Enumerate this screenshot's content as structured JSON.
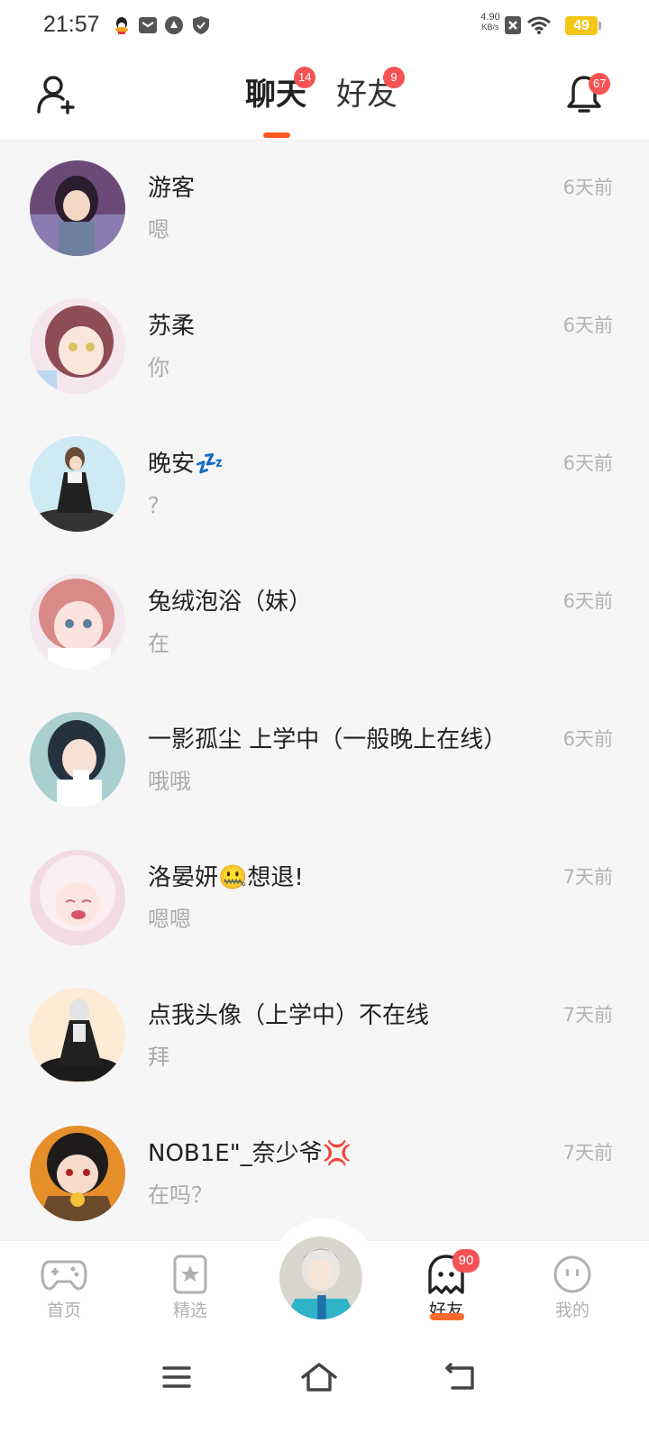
{
  "status_bar": {
    "time": "21:57",
    "net_speed_value": "4.90",
    "net_speed_unit": "KB/s",
    "battery": "49",
    "icons": [
      "qq-icon",
      "mail-icon",
      "sync-icon",
      "shield-icon",
      "sim-x-icon",
      "wifi-icon",
      "battery-icon"
    ]
  },
  "header": {
    "tabs": [
      {
        "label": "聊天",
        "badge": "14",
        "active": true
      },
      {
        "label": "好友",
        "badge": "9",
        "active": false
      }
    ],
    "notification_badge": "67",
    "accent": "#ff5a1f"
  },
  "chats": [
    {
      "name": "游客",
      "message": "嗯",
      "time": "6天前"
    },
    {
      "name": "苏柔",
      "message": "你",
      "time": "6天前"
    },
    {
      "name": "晚安💤",
      "message": "？",
      "time": "6天前"
    },
    {
      "name": "兔绒泡浴（妹）",
      "message": "在",
      "time": "6天前"
    },
    {
      "name": "一影孤尘 上学中（一般晚上在线）",
      "message": "哦哦",
      "time": "6天前"
    },
    {
      "name": "洛晏妍🤐想退!",
      "message": "嗯嗯",
      "time": "7天前"
    },
    {
      "name": "点我头像（上学中）不在线",
      "message": "拜",
      "time": "7天前"
    },
    {
      "name": "NOB1E\"_奈少爷💢",
      "message": "在吗？",
      "time": "7天前"
    }
  ],
  "bottom_nav": {
    "items": [
      {
        "label": "首页",
        "icon": "gamepad-icon"
      },
      {
        "label": "精选",
        "icon": "star-bookmark-icon"
      },
      {
        "label": "好友",
        "icon": "ghost-icon",
        "badge": "90",
        "active": true
      },
      {
        "label": "我的",
        "icon": "smiley-icon"
      }
    ]
  }
}
